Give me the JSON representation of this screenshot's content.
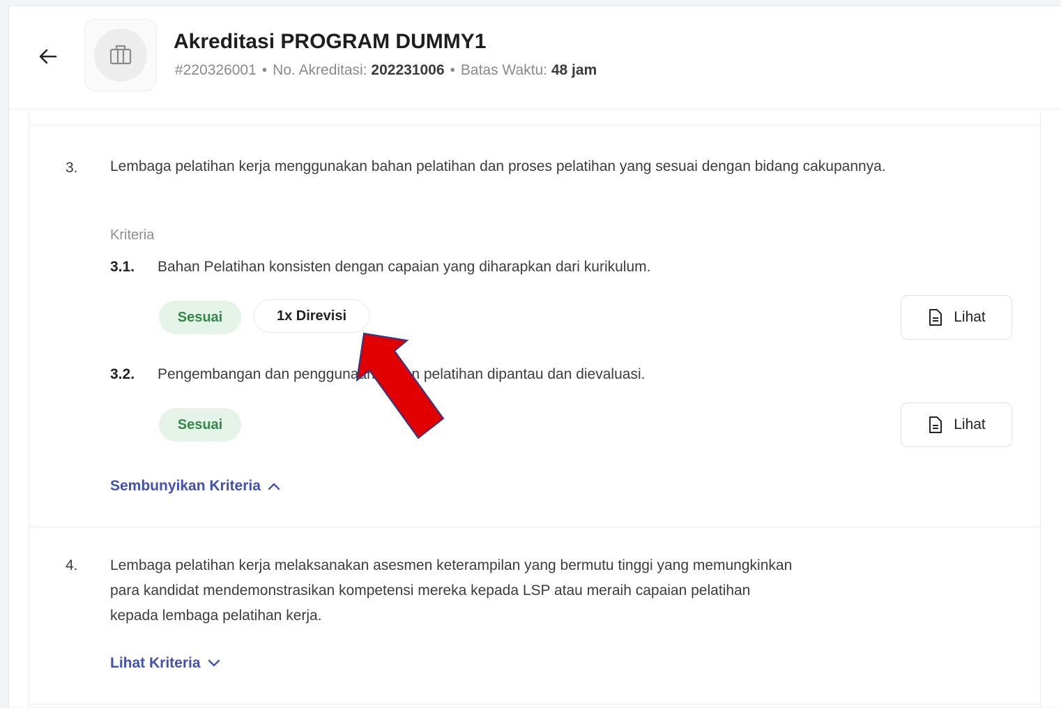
{
  "header": {
    "title": "Akreditasi PROGRAM DUMMY1",
    "id": "#220326001",
    "accreditation_label": "No. Akreditasi:",
    "accreditation_number": "202231006",
    "deadline_label": "Batas Waktu:",
    "deadline_value": "48 jam",
    "separator": "•"
  },
  "items": [
    {
      "number": "3.",
      "description": "Lembaga pelatihan kerja menggunakan bahan pelatihan dan proses pelatihan yang sesuai dengan bidang cakupannya.",
      "kriteria_label": "Kriteria",
      "criteria": [
        {
          "number": "3.1.",
          "text": "Bahan Pelatihan konsisten dengan capaian yang diharapkan dari kurikulum.",
          "status": "Sesuai",
          "revision": "1x Direvisi",
          "action": "Lihat"
        },
        {
          "number": "3.2.",
          "text": "Pengembangan dan penggunaan bahan pelatihan dipantau dan dievaluasi.",
          "status": "Sesuai",
          "action": "Lihat"
        }
      ],
      "toggle_label": "Sembunyikan Kriteria"
    },
    {
      "number": "4.",
      "description_lines": [
        "Lembaga pelatihan kerja melaksanakan asesmen keterampilan yang bermutu tinggi yang memungkinkan",
        "para kandidat mendemonstrasikan kompetensi mereka kepada LSP atau meraih capaian pelatihan",
        "kepada lembaga pelatihan kerja."
      ],
      "toggle_label": "Lihat Kriteria"
    }
  ],
  "colors": {
    "accent_link": "#3f51b5",
    "status_green_bg": "#e5f3e8",
    "status_green_text": "#2f8a46",
    "annotation_arrow": "#e00000"
  },
  "icons": {
    "back": "arrow-left-icon",
    "logo": "building-icon",
    "document": "document-icon",
    "chevron_up": "chevron-up-icon",
    "chevron_down": "chevron-down-icon"
  }
}
